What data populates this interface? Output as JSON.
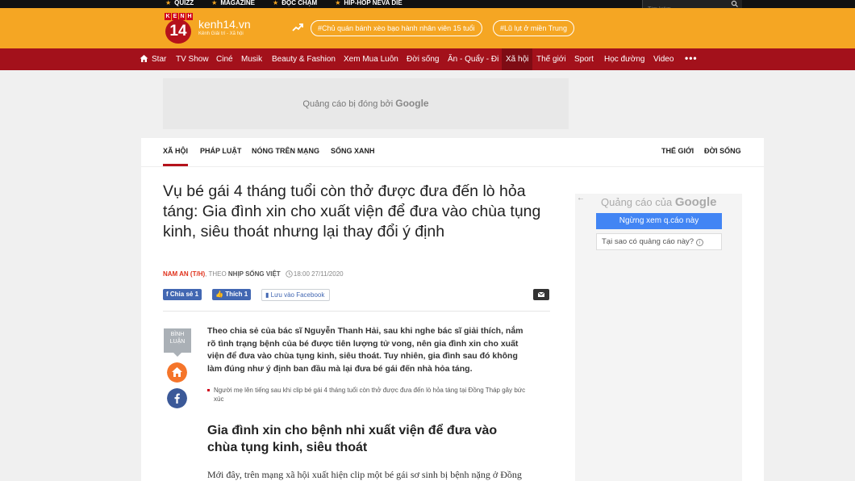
{
  "topbar": {
    "links": [
      "QUIZZ",
      "MAGAZINE",
      "ĐỌC CHẬM",
      "HIP-HOP NEVA DIE"
    ],
    "search_placeholder": "Tìm kiếm..."
  },
  "header": {
    "logo_letters": [
      "K",
      "E",
      "N",
      "H"
    ],
    "logo_number": "14",
    "site_name": "kenh14.vn",
    "tagline": "Kênh Giải trí - Xã hội",
    "trending": [
      "#Chủ quán bánh xèo bạo hành nhân viên 15 tuổi",
      "#Lũ lụt ở miền Trung"
    ]
  },
  "nav": {
    "items": [
      "Star",
      "TV Show",
      "Ciné",
      "Musik",
      "Beauty & Fashion",
      "Xem Mua Luôn",
      "Đời sống",
      "Ăn - Quẩy - Đi",
      "Xã hội",
      "Thế giới",
      "Sport",
      "Học đường",
      "Video"
    ],
    "more": "•••"
  },
  "ad_banner": {
    "text": "Quảng cáo bị đóng bởi",
    "brand": "Google"
  },
  "categories": {
    "left": [
      "XÃ HỘI",
      "PHÁP LUẬT",
      "NÓNG TRÊN MẠNG",
      "SỐNG XANH"
    ],
    "right": [
      "THẾ GIỚI",
      "ĐỜI SỐNG"
    ]
  },
  "article": {
    "title": "Vụ bé gái 4 tháng tuổi còn thở được đưa đến lò hỏa táng: Gia đình xin cho xuất viện để đưa vào chùa tụng kinh, siêu thoát nhưng lại thay đổi ý định",
    "author": "NAM AN (T/H)",
    "source_prefix": ", THEO",
    "source": "NHỊP SỐNG VIỆT",
    "time": "18:00 27/11/2020",
    "share_label": "Chia sẻ 1",
    "like_label": "Thích 1",
    "save_label": "Lưu vào Facebook",
    "comment_label": "BÌNH LUẬN",
    "sapo": "Theo chia sẻ của bác sĩ Nguyễn Thanh Hải, sau khi nghe bác sĩ giải thích, nắm rõ tình trạng bệnh của bé được tiên lượng tử vong, nên gia đình xin cho xuất viện để đưa vào chùa tụng kinh, siêu thoát. Tuy nhiên, gia đình sau đó không làm đúng như ý định ban đầu mà lại đưa bé gái đến nhà hỏa táng.",
    "related": "Người mẹ lên tiếng sau khi clip bé gái 4 tháng tuổi còn thở được đưa đến lò hỏa táng tại Đồng Tháp gây bức xúc",
    "heading": "Gia đình xin cho bệnh nhi xuất viện để đưa vào chùa tụng kinh, siêu thoát",
    "body": "Mới đây, trên mạng xã hội xuất hiện clip một bé gái sơ sinh bị bệnh nặng ở Đồng"
  },
  "side_ad": {
    "back": "←",
    "head": "Quảng cáo của",
    "brand": "Google",
    "stop": "Ngừng xem q.cáo này",
    "why": "Tại sao có quảng cáo này?",
    "info": "i"
  },
  "colors": {
    "orange": "#f5a623",
    "nav_red": "#a3111b",
    "accent_red": "#b5121b",
    "facebook": "#4267b2",
    "google_blue": "#4285f4"
  }
}
